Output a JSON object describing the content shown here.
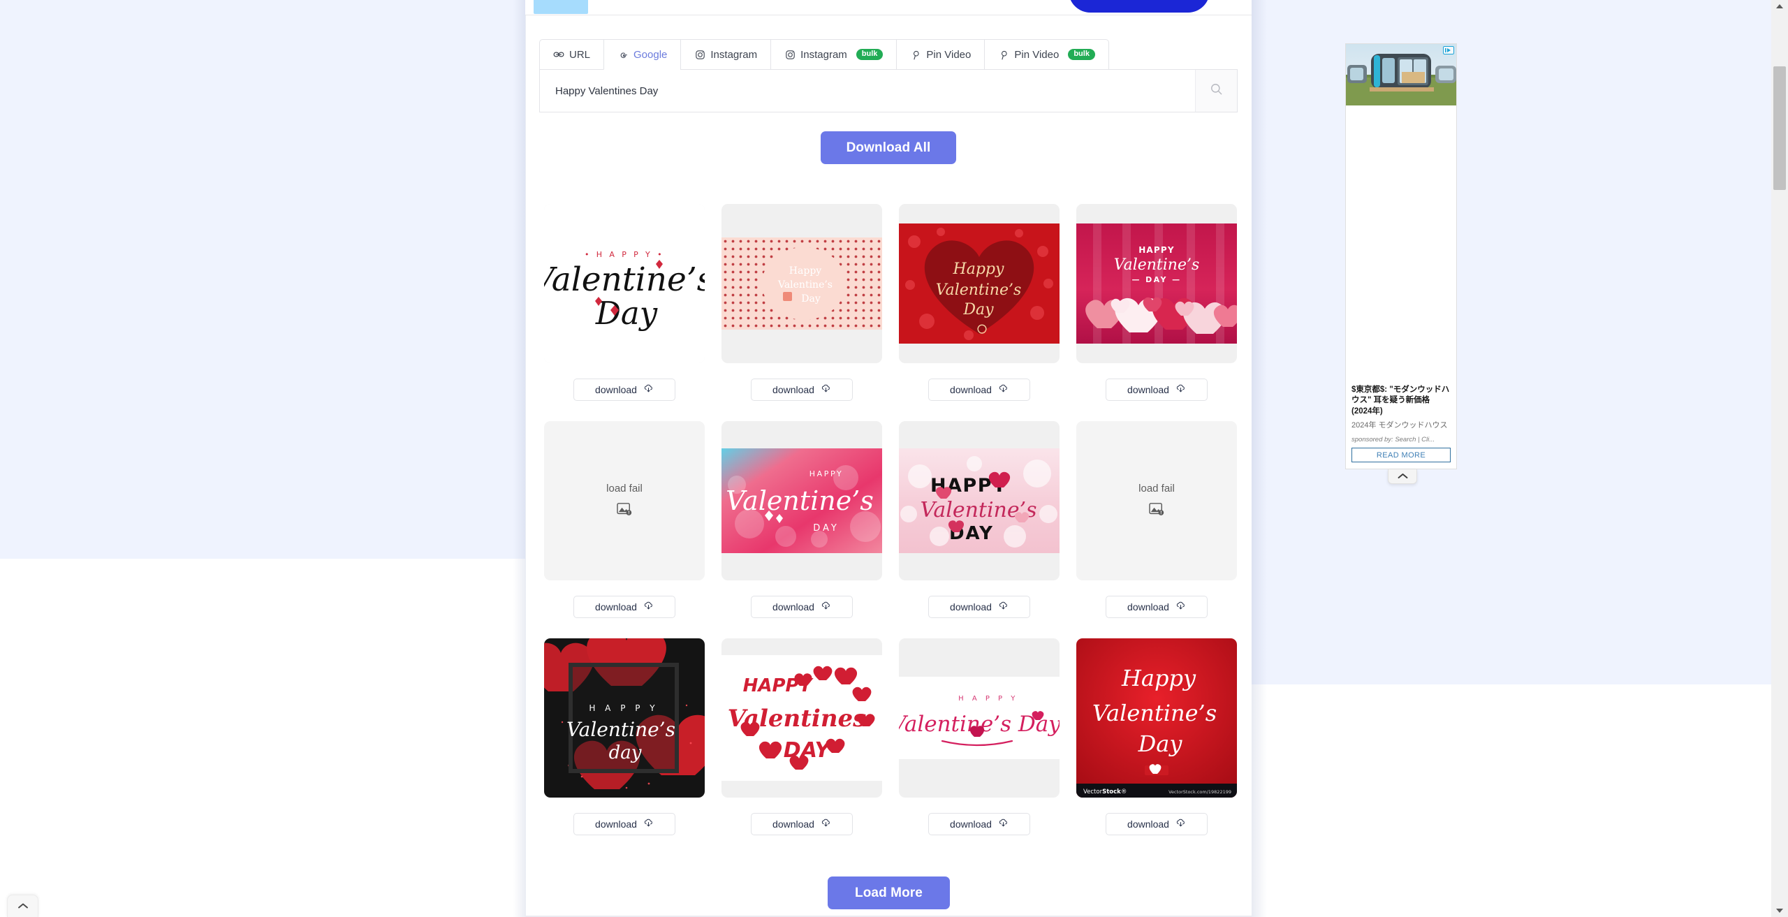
{
  "page": {
    "background_color": "#eff3fe",
    "content_background": "#ffffff",
    "accent_color": "#6b78e8",
    "badge_color": "#22ac55"
  },
  "tabs": [
    {
      "label": "URL",
      "icon": "link-icon",
      "active": false,
      "badge": null
    },
    {
      "label": "Google",
      "icon": "google-g-icon",
      "active": true,
      "badge": null
    },
    {
      "label": "Instagram",
      "icon": "instagram-icon",
      "active": false,
      "badge": null
    },
    {
      "label": "Instagram",
      "icon": "instagram-icon",
      "active": false,
      "badge": "bulk"
    },
    {
      "label": "Pin Video",
      "icon": "pinterest-icon",
      "active": false,
      "badge": null
    },
    {
      "label": "Pin Video",
      "icon": "pinterest-icon",
      "active": false,
      "badge": "bulk"
    }
  ],
  "search": {
    "value": "Happy Valentines Day",
    "placeholder": "Happy Valentines Day",
    "button_icon": "search-icon"
  },
  "actions": {
    "download_all": "Download All",
    "load_more": "Load More",
    "download": "download",
    "download_icon": "cloud-download-icon"
  },
  "results": {
    "count": 12,
    "columns": 4,
    "fail_text": "load fail",
    "fail_icon": "broken-image-icon",
    "items": [
      {
        "index": 1,
        "status": "ok",
        "alt": "Happy Valentine's Day black brush script lettering with red hearts on white",
        "style": "white-script"
      },
      {
        "index": 2,
        "status": "ok",
        "alt": "Happy Valentine's Day serif text on pale pink halftone dot circle",
        "style": "pink-halftone"
      },
      {
        "index": 3,
        "status": "ok",
        "alt": "Happy Valentine's Day gold script on dark red floral heart frame",
        "style": "red-floral"
      },
      {
        "index": 4,
        "status": "ok",
        "alt": "Happy Valentine's Day over pink and white glossy hearts on magenta",
        "style": "magenta-hearts"
      },
      {
        "index": 5,
        "status": "fail",
        "alt": "load fail",
        "style": "fail"
      },
      {
        "index": 6,
        "status": "ok",
        "alt": "Happy Valentine's Day white script on pink and blue bokeh gradient",
        "style": "pink-bokeh"
      },
      {
        "index": 7,
        "status": "ok",
        "alt": "HAPPY Valentine's DAY black and crimson text on soft pink bokeh hearts",
        "style": "soft-pink"
      },
      {
        "index": 8,
        "status": "fail",
        "alt": "load fail",
        "style": "fail"
      },
      {
        "index": 9,
        "status": "ok",
        "alt": "Happy Valentine's day white script in glossy frame on black with red glitter hearts",
        "style": "black-glitter"
      },
      {
        "index": 10,
        "status": "ok",
        "alt": "Happy Valentines Day red lettering arranged in a heart shape on white",
        "style": "heart-type"
      },
      {
        "index": 11,
        "status": "ok",
        "alt": "HAPPY Valentine's Day pink brush script with small heart on white",
        "style": "pink-script"
      },
      {
        "index": 12,
        "status": "ok",
        "alt": "Happy Valentine's Day white calligraphy on red gradient VectorStock image",
        "style": "red-vector"
      }
    ]
  },
  "ad": {
    "title": "$東京都$: \"モダンウッドハウス\" 耳を疑う新価格 (2024年)",
    "description": "2024年 モダンウッドハウス",
    "sponsored": "sponsored by: Search | Cli...",
    "cta": "READ MORE",
    "choices_icon": "ad-choices-icon",
    "collapse_icon": "chevron-up-icon"
  },
  "scroll_top": {
    "icon": "chevron-up-icon"
  },
  "scrollbar": {
    "up_icon": "scroll-up-arrow",
    "down_icon": "scroll-down-arrow"
  }
}
